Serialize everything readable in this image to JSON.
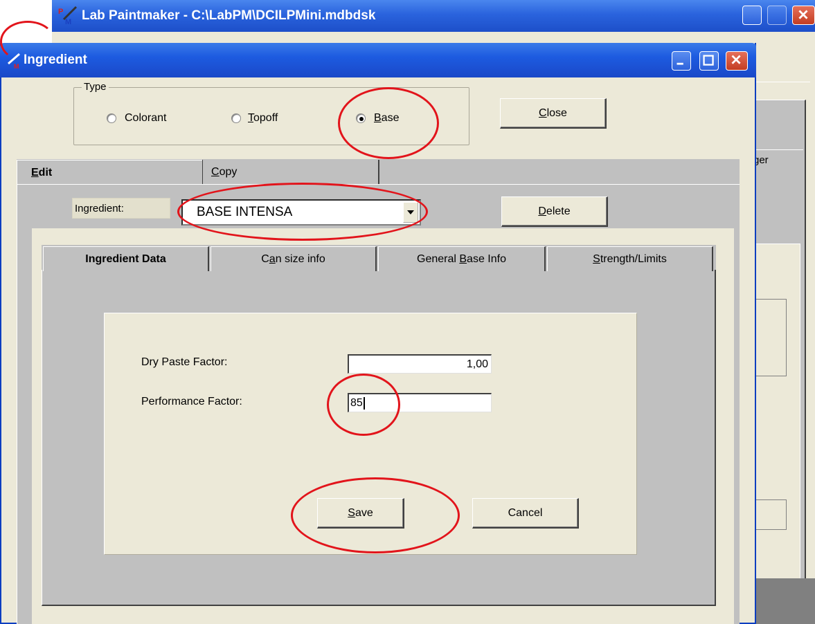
{
  "app_window": {
    "title": "Lab Paintmaker - C:\\LabPM\\DCILPMini.mdbdsk",
    "partial_right_tab_label": "ger"
  },
  "dialog": {
    "title": "Ingredient",
    "type_group": {
      "legend": "Type",
      "options": [
        {
          "label": "Colorant",
          "selected": false
        },
        {
          "label": "Topoff",
          "selected": false
        },
        {
          "label": "Base",
          "selected": true
        }
      ]
    },
    "close_button": "Close",
    "outer_tabs": [
      "Edit",
      "Copy"
    ],
    "ingredient_label": "Ingredient:",
    "ingredient_value": "BASE INTENSA",
    "delete_button": "Delete",
    "inner_tabs": [
      "Ingredient Data",
      "Can size info",
      "General Base Info",
      "Strength/Limits"
    ],
    "fields": {
      "dry_paste_label": "Dry Paste Factor:",
      "dry_paste_value": "1,00",
      "performance_label": "Performance Factor:",
      "performance_value": "85"
    },
    "save_button": "Save",
    "cancel_button": "Cancel"
  },
  "colors": {
    "xp_title": "#1d5be0",
    "face": "#ece9d8",
    "tab_gray": "#c0c0c0",
    "annotation": "#e2141b"
  }
}
